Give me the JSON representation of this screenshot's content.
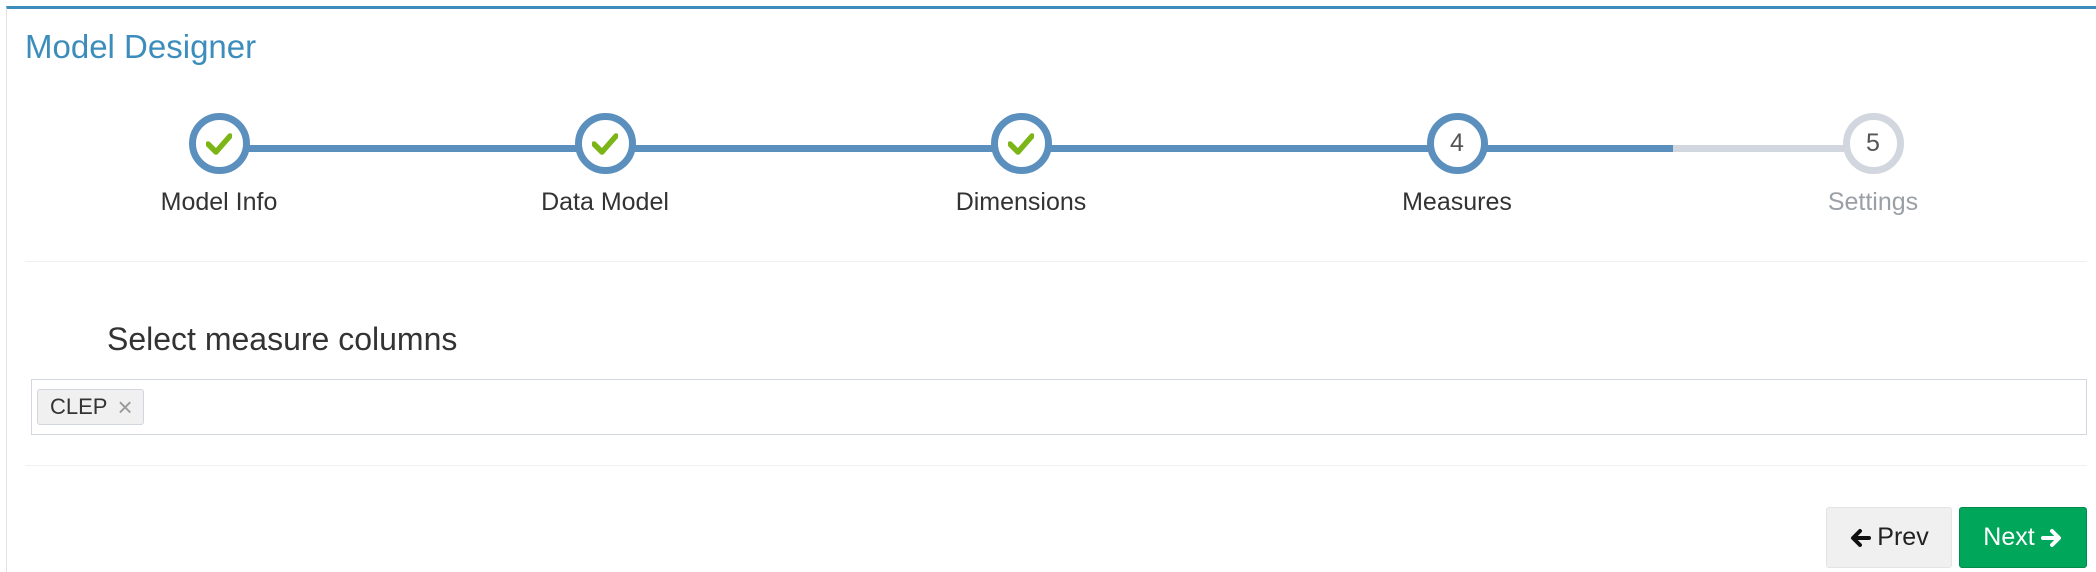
{
  "panel": {
    "title": "Model Designer"
  },
  "wizard": {
    "steps": [
      {
        "label": "Model Info",
        "state": "completed",
        "number": "1"
      },
      {
        "label": "Data Model",
        "state": "completed",
        "number": "2"
      },
      {
        "label": "Dimensions",
        "state": "completed",
        "number": "3"
      },
      {
        "label": "Measures",
        "state": "active",
        "number": "4"
      },
      {
        "label": "Settings",
        "state": "pending",
        "number": "5"
      }
    ],
    "progress_percent": 91
  },
  "measures": {
    "section_title": "Select measure columns",
    "selected": [
      {
        "label": "CLEP",
        "remove_icon": "close-icon"
      }
    ]
  },
  "footer": {
    "prev_label": "Prev",
    "next_label": "Next",
    "prev_icon": "arrow-left-icon",
    "next_icon": "arrow-right-icon"
  },
  "colors": {
    "brand": "#3c8dbc",
    "step_done": "#5b8fbe",
    "step_pending": "#d2d6de",
    "check": "#7cb518",
    "next_button": "#00a65a"
  }
}
